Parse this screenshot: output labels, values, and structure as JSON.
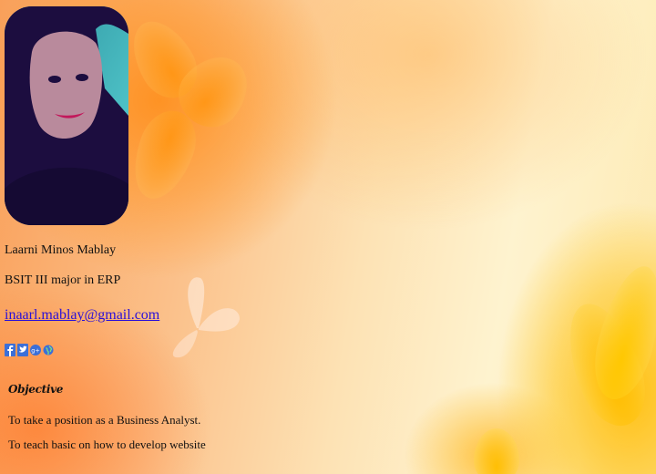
{
  "profile": {
    "name": "Laarni Minos Mablay",
    "course": "BSIT III major in ERP",
    "email": "inaarl.mablay@gmail.com",
    "avatar_alt": "profile photo"
  },
  "social": [
    {
      "icon": "facebook-icon",
      "color": "#3b6fd8"
    },
    {
      "icon": "twitter-icon",
      "color": "#3b6fd8"
    },
    {
      "icon": "google-plus-icon",
      "color": "#3b6fd8"
    },
    {
      "icon": "globe-icon",
      "color": "#3b6fd8"
    }
  ],
  "objective": {
    "title": "Objective",
    "items": [
      "To take a position as a Business Analyst.",
      "To teach basic on how to develop website"
    ]
  },
  "colors": {
    "link": "#2a0fd8",
    "icon": "#3b6fd8",
    "background_warm": "#f9a05a",
    "background_light": "#fef3cf"
  }
}
